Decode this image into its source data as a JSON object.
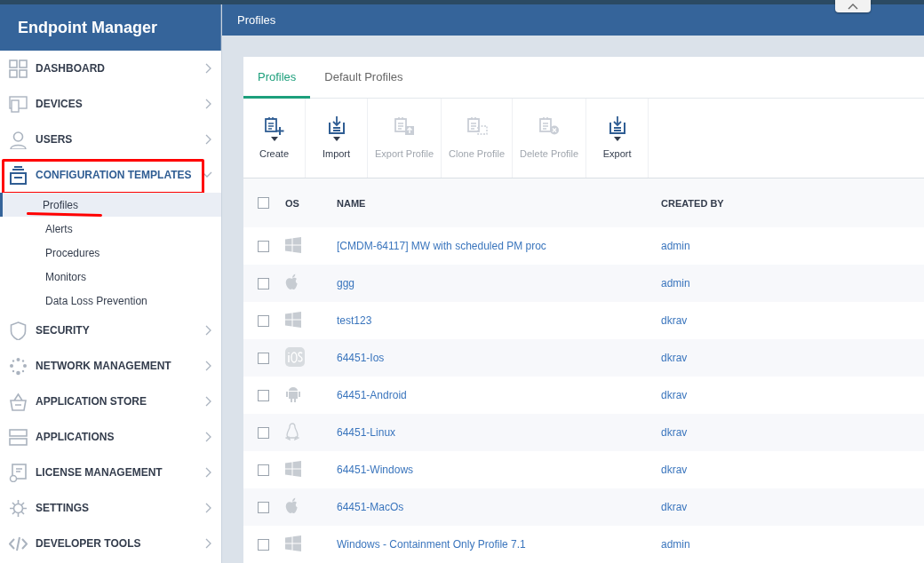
{
  "app_title": "Endpoint Manager",
  "page_title": "Profiles",
  "sidebar": {
    "items": [
      {
        "label": "DASHBOARD",
        "expanded": false,
        "highlighted": false
      },
      {
        "label": "DEVICES",
        "expanded": false,
        "highlighted": false
      },
      {
        "label": "USERS",
        "expanded": false,
        "highlighted": false
      },
      {
        "label": "CONFIGURATION TEMPLATES",
        "expanded": true,
        "highlighted": true,
        "children": [
          {
            "label": "Profiles",
            "selected": true,
            "underlined": true
          },
          {
            "label": "Alerts",
            "selected": false,
            "underlined": false
          },
          {
            "label": "Procedures",
            "selected": false,
            "underlined": false
          },
          {
            "label": "Monitors",
            "selected": false,
            "underlined": false
          },
          {
            "label": "Data Loss Prevention",
            "selected": false,
            "underlined": false
          }
        ]
      },
      {
        "label": "SECURITY",
        "expanded": false,
        "highlighted": false
      },
      {
        "label": "NETWORK MANAGEMENT",
        "expanded": false,
        "highlighted": false
      },
      {
        "label": "APPLICATION STORE",
        "expanded": false,
        "highlighted": false
      },
      {
        "label": "APPLICATIONS",
        "expanded": false,
        "highlighted": false
      },
      {
        "label": "LICENSE MANAGEMENT",
        "expanded": false,
        "highlighted": false
      },
      {
        "label": "SETTINGS",
        "expanded": false,
        "highlighted": false
      },
      {
        "label": "DEVELOPER TOOLS",
        "expanded": false,
        "highlighted": false
      }
    ]
  },
  "tabs": [
    {
      "label": "Profiles",
      "selected": true
    },
    {
      "label": "Default Profiles",
      "selected": false
    }
  ],
  "toolbar": [
    {
      "label": "Create",
      "kind": "create",
      "disabled": false,
      "dropdown": true
    },
    {
      "label": "Import",
      "kind": "import",
      "disabled": false,
      "dropdown": true
    },
    {
      "label": "Export Profile",
      "kind": "export_profile",
      "disabled": true,
      "dropdown": false
    },
    {
      "label": "Clone Profile",
      "kind": "clone",
      "disabled": true,
      "dropdown": false
    },
    {
      "label": "Delete Profile",
      "kind": "delete",
      "disabled": true,
      "dropdown": false
    },
    {
      "label": "Export",
      "kind": "export",
      "disabled": false,
      "dropdown": true
    }
  ],
  "table": {
    "columns": [
      "OS",
      "NAME",
      "CREATED BY"
    ],
    "header_checked": false,
    "rows": [
      {
        "kind": "windows",
        "name": "[CMDM-64117] MW with scheduled PM proc",
        "created_by": "admin",
        "checked": false
      },
      {
        "kind": "apple",
        "name": "ggg",
        "created_by": "admin",
        "checked": false
      },
      {
        "kind": "windows",
        "name": "test123",
        "created_by": "dkrav",
        "checked": false
      },
      {
        "kind": "ios",
        "name": "64451-Ios",
        "created_by": "dkrav",
        "checked": false
      },
      {
        "kind": "android",
        "name": "64451-Android",
        "created_by": "dkrav",
        "checked": false
      },
      {
        "kind": "linux",
        "name": "64451-Linux",
        "created_by": "dkrav",
        "checked": false
      },
      {
        "kind": "windows",
        "name": "64451-Windows",
        "created_by": "dkrav",
        "checked": false
      },
      {
        "kind": "apple",
        "name": "64451-MacOs",
        "created_by": "dkrav",
        "checked": false
      },
      {
        "kind": "windows",
        "name": "Windows - Containment Only Profile 7.1",
        "created_by": "admin",
        "checked": false
      }
    ]
  }
}
